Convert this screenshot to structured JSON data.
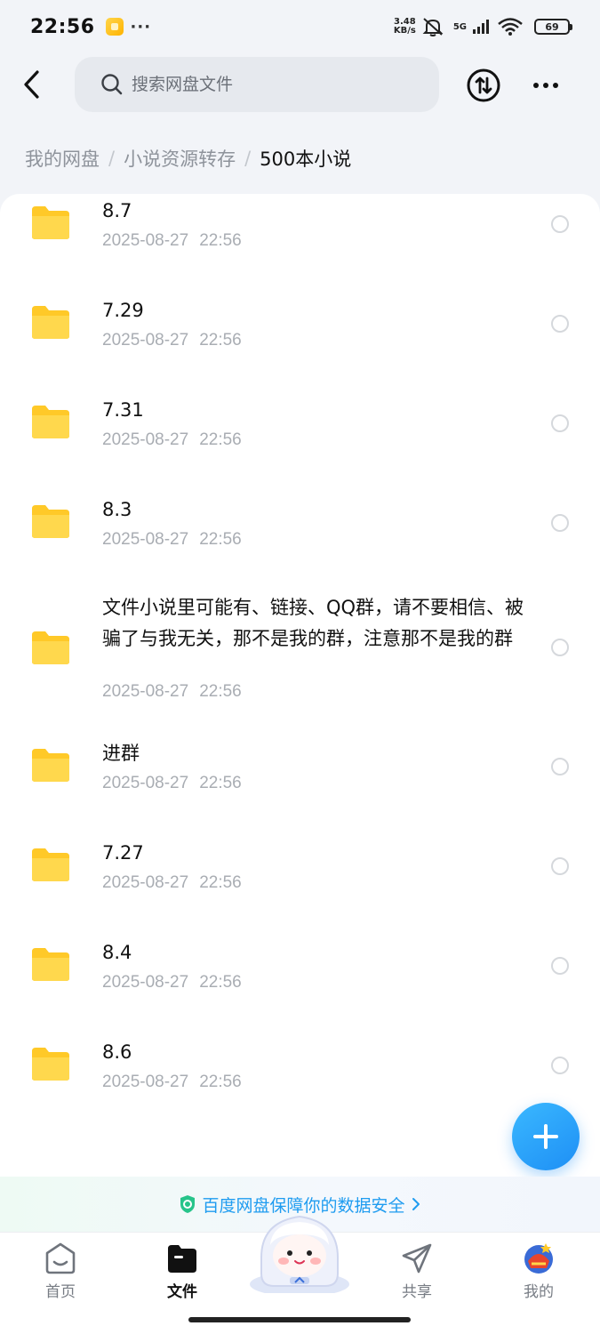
{
  "status_bar": {
    "time": "22:56",
    "more_dots": "···",
    "speed_value": "3.48",
    "speed_unit": "KB/s",
    "network": "5G",
    "battery": "69"
  },
  "header": {
    "search_placeholder": "搜索网盘文件"
  },
  "breadcrumb": {
    "items": [
      "我的网盘",
      "小说资源转存",
      "500本小说"
    ],
    "separator": "/"
  },
  "files": [
    {
      "name": "8.7",
      "date": "2025-08-27",
      "time": "22:56"
    },
    {
      "name": "7.29",
      "date": "2025-08-27",
      "time": "22:56"
    },
    {
      "name": "7.31",
      "date": "2025-08-27",
      "time": "22:56"
    },
    {
      "name": "8.3",
      "date": "2025-08-27",
      "time": "22:56"
    },
    {
      "name": "文件小说里可能有、链接、QQ群，请不要相信、被骗了与我无关，那不是我的群，注意那不是我的群",
      "date": "2025-08-27",
      "time": "22:56"
    },
    {
      "name": "进群",
      "date": "2025-08-27",
      "time": "22:56"
    },
    {
      "name": "7.27",
      "date": "2025-08-27",
      "time": "22:56"
    },
    {
      "name": "8.4",
      "date": "2025-08-27",
      "time": "22:56"
    },
    {
      "name": "8.6",
      "date": "2025-08-27",
      "time": "22:56"
    }
  ],
  "safety_banner": {
    "text": "百度网盘保障你的数据安全"
  },
  "bottom_nav": {
    "home": "首页",
    "files": "文件",
    "share": "共享",
    "mine": "我的"
  },
  "colors": {
    "accent": "#1e8ff5",
    "folder": "#ffcc2e",
    "background": "#f2f4f8"
  }
}
